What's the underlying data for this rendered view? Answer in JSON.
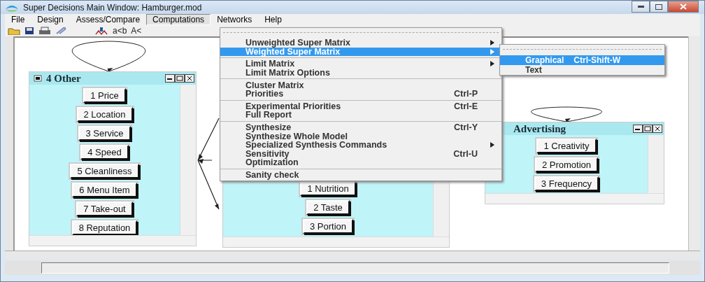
{
  "window": {
    "title": "Super Decisions Main Window: Hamburger.mod"
  },
  "menubar": [
    {
      "label": "File",
      "selected": false
    },
    {
      "label": "Design",
      "selected": false
    },
    {
      "label": "Assess/Compare",
      "selected": false
    },
    {
      "label": "Computations",
      "selected": true
    },
    {
      "label": "Networks",
      "selected": false
    },
    {
      "label": "Help",
      "selected": false
    }
  ],
  "toolbar": {
    "texts": [
      "a<b",
      "A<"
    ]
  },
  "clusters": [
    {
      "title": "4 Other",
      "has_loop": true,
      "nodes": [
        "1 Price",
        "2 Location",
        "3 Service",
        "4 Speed",
        "5 Cleanliness",
        "6 Menu Item",
        "7 Take-out",
        "8 Reputation"
      ]
    },
    {
      "has_loop": false,
      "nodes": [
        "1 Nutrition",
        "2 Taste",
        "3 Portion"
      ]
    },
    {
      "title": "Advertising",
      "has_loop": true,
      "nodes": [
        "1 Creativity",
        "2 Promotion",
        "3 Frequency"
      ]
    }
  ],
  "menu": {
    "groups": [
      [
        {
          "label": "Unweighted Super Matrix",
          "has_submenu": true,
          "selected": false
        },
        {
          "label": "Weighted Super Matrix",
          "has_submenu": true,
          "selected": true
        }
      ],
      [
        {
          "label": "Limit Matrix",
          "has_submenu": true,
          "selected": false
        },
        {
          "label": "Limit Matrix Options",
          "selected": false
        }
      ],
      [
        {
          "label": "Cluster Matrix",
          "selected": false
        },
        {
          "label": "Priorities",
          "shortcut": "Ctrl-P",
          "selected": false
        }
      ],
      [
        {
          "label": "Experimental Priorities",
          "shortcut": "Ctrl-E",
          "selected": false
        },
        {
          "label": "Full Report",
          "selected": false
        }
      ],
      [
        {
          "label": "Synthesize",
          "shortcut": "Ctrl-Y",
          "selected": false
        },
        {
          "label": "Synthesize Whole Model",
          "selected": false
        },
        {
          "label": "Specialized Synthesis Commands",
          "has_submenu": true,
          "selected": false
        },
        {
          "label": "Sensitivity",
          "shortcut": "Ctrl-U",
          "selected": false
        },
        {
          "label": "Optimization",
          "selected": false
        }
      ],
      [
        {
          "label": "Sanity check",
          "selected": false
        }
      ]
    ]
  },
  "submenu": {
    "items": [
      {
        "label": "Graphical",
        "shortcut": "Ctrl-Shift-W",
        "selected": true
      },
      {
        "label": "Text",
        "selected": false
      }
    ]
  }
}
